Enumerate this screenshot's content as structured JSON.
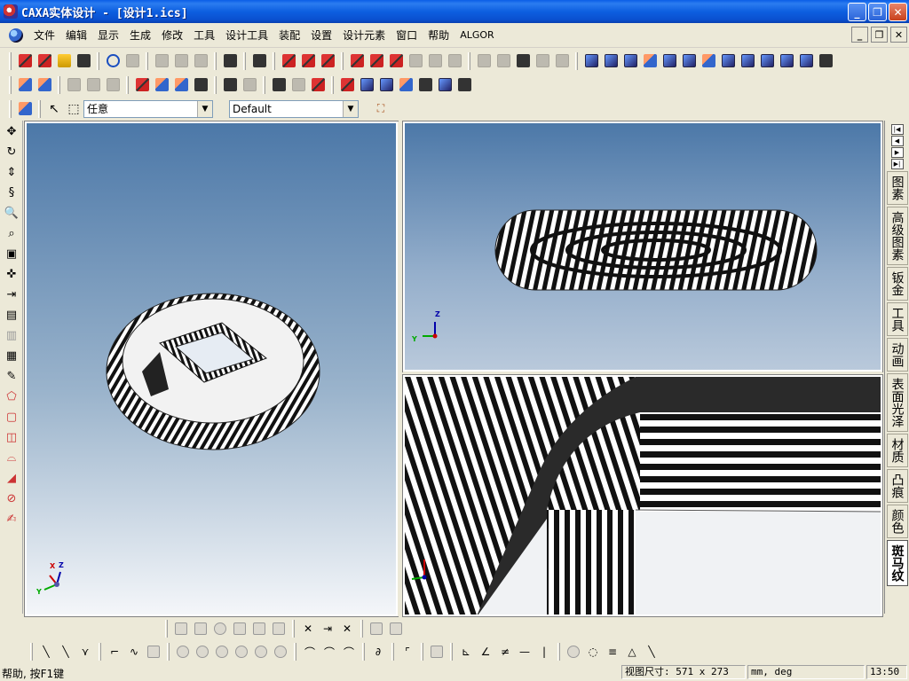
{
  "window": {
    "title": "CAXA实体设计 - [设计1.ics]"
  },
  "menu": {
    "items": [
      "文件",
      "编辑",
      "显示",
      "生成",
      "修改",
      "工具",
      "设计工具",
      "装配",
      "设置",
      "设计元素",
      "窗口",
      "帮助",
      "ALGOR"
    ]
  },
  "toolbar": {
    "selection_filter": "任意",
    "style_dropdown": "Default"
  },
  "right_tabs": {
    "items": [
      "图素",
      "高级图素",
      "钣金",
      "工具",
      "动画",
      "表面光泽",
      "材质",
      "凸痕",
      "颜色",
      "斑马纹"
    ],
    "active": "斑马纹"
  },
  "axes": {
    "x": "X",
    "y": "Y",
    "z": "Z"
  },
  "statusbar": {
    "help": "帮助, 按F1键",
    "view_size_label": "视图尺寸:",
    "view_size_value": "571 x  273",
    "units": "mm, deg",
    "time": "13:50"
  },
  "colors": {
    "titlebar": "#0a5de7",
    "viewport_top": "#4c78a8",
    "viewport_bottom": "#f4f6f9"
  }
}
